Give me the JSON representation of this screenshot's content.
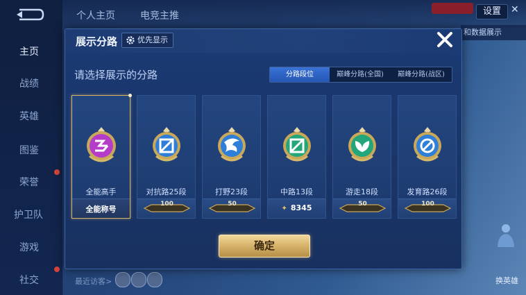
{
  "sidebar": {
    "items": [
      {
        "label": "主页",
        "active": true
      },
      {
        "label": "战绩"
      },
      {
        "label": "英雄"
      },
      {
        "label": "图鉴"
      },
      {
        "label": "荣誉"
      },
      {
        "label": "护卫队"
      },
      {
        "label": "游戏"
      },
      {
        "label": "社交"
      }
    ]
  },
  "top_tabs": [
    "个人主页",
    "电竞主推"
  ],
  "top_right": {
    "settings_label": "设置",
    "close_glyph": "✕",
    "share_label": "和数据展示"
  },
  "recent_visitors_label": "最近访客>",
  "right_figure_label": "换英雄",
  "modal": {
    "title": "展示分路",
    "priority_label": "优先显示",
    "prompt": "请选择展示的分路",
    "tabs": [
      {
        "label": "分路段位",
        "active": true
      },
      {
        "label": "巅峰分路(全国)"
      },
      {
        "label": "巅峰分路(战区)"
      }
    ],
    "cards": [
      {
        "label": "全能高手",
        "footer": "全能称号",
        "icon": "all-round-emblem-icon",
        "color": "#b43cc8",
        "selected": true
      },
      {
        "label": "对抗路25段",
        "badge": "100",
        "icon": "clash-lane-emblem-icon",
        "color": "#2f7fd8"
      },
      {
        "label": "打野23段",
        "badge": "50",
        "icon": "jungle-emblem-icon",
        "color": "#2f7fd8"
      },
      {
        "label": "中路13段",
        "power": "8345",
        "icon": "mid-lane-emblem-icon",
        "color": "#22a67a"
      },
      {
        "label": "游走18段",
        "badge": "50",
        "icon": "roam-emblem-icon",
        "color": "#22a67a"
      },
      {
        "label": "发育路26段",
        "badge": "100",
        "icon": "farm-lane-emblem-icon",
        "color": "#2f7fd8"
      }
    ],
    "confirm_label": "确定"
  }
}
